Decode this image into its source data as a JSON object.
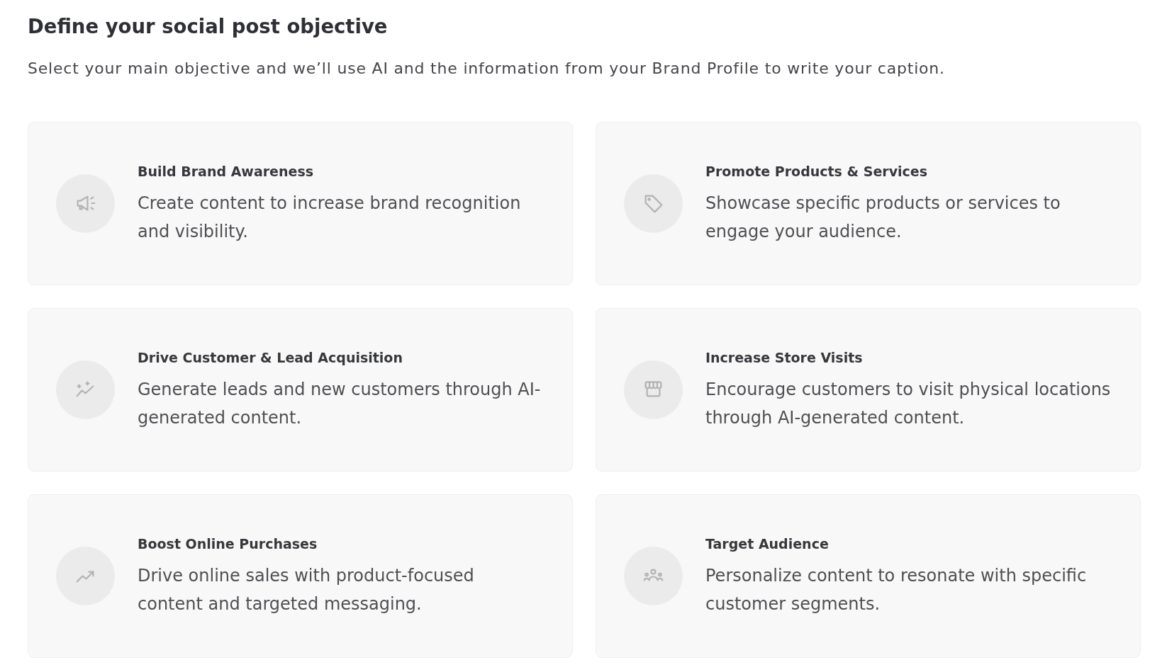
{
  "header": {
    "title": "Define your social post objective",
    "subtitle": "Select your main objective and we’ll use AI and the information from your Brand Profile to write your caption."
  },
  "objectives": [
    {
      "title": "Build Brand Awareness",
      "description": "Create content to increase brand recognition and visibility.",
      "selected": false
    },
    {
      "title": "Promote Products & Services",
      "description": "Showcase specific products or services to engage your audience.",
      "selected": false
    },
    {
      "title": "Drive Customer & Lead Acquisition",
      "description": "Generate leads and new customers through AI-generated content.",
      "selected": false
    },
    {
      "title": "Increase Store Visits",
      "description": "Encourage customers to visit physical locations through AI-generated content.",
      "selected": false
    },
    {
      "title": "Boost Online Purchases",
      "description": "Drive online sales with product-focused content and targeted messaging.",
      "selected": false
    },
    {
      "title": "Target Audience",
      "description": "Personalize content to resonate with specific customer segments.",
      "selected": false
    }
  ]
}
